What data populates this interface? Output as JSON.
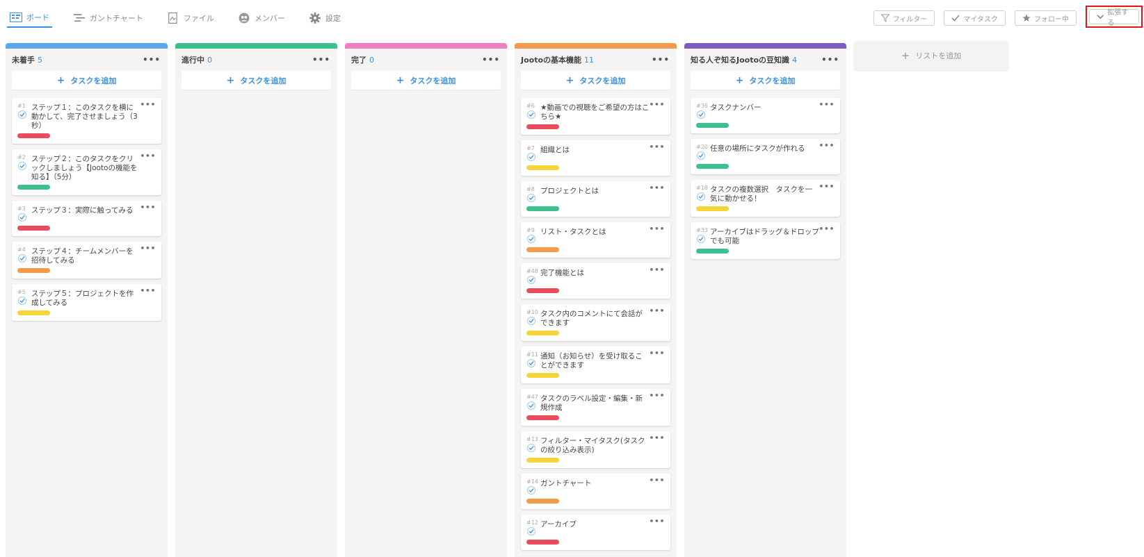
{
  "nav": {
    "tabs": [
      {
        "label": "ボード",
        "icon": "board-icon"
      },
      {
        "label": "ガントチャート",
        "icon": "gantt-icon"
      },
      {
        "label": "ファイル",
        "icon": "file-icon"
      },
      {
        "label": "メンバー",
        "icon": "member-icon"
      },
      {
        "label": "設定",
        "icon": "gear-icon"
      }
    ],
    "tools": {
      "filter": "フィルター",
      "mytask": "マイタスク",
      "follow": "フォロー中",
      "expand": "拡張する"
    }
  },
  "colors": {
    "accent": "#3b8fe0",
    "red": "#ea4c5c",
    "green": "#3cc08e",
    "orange": "#f39a4b",
    "yellow": "#f7d43a",
    "pink": "#ee7fbf",
    "purple": "#7e5cc2",
    "blue": "#5aa8ea"
  },
  "board": {
    "add_task_label": "タスクを追加",
    "add_list_label": "リストを追加",
    "columns": [
      {
        "name": "未着手",
        "count": "5",
        "color": "#5aa8ea",
        "cards": [
          {
            "num": "#1",
            "title": "ステップ１：このタスクを横に動かして、完了させましょう（3秒）",
            "label": "#ea4c5c"
          },
          {
            "num": "#2",
            "title": "ステップ２：このタスクをクリックしましょう【Jootoの機能を知る】（5分）",
            "label": "#3cc08e"
          },
          {
            "num": "#3",
            "title": "ステップ３：実際に触ってみる",
            "label": "#ea4c5c"
          },
          {
            "num": "#4",
            "title": "ステップ４：チームメンバーを招待してみる",
            "label": "#f39a4b"
          },
          {
            "num": "#5",
            "title": "ステップ５：プロジェクトを作成してみる",
            "label": "#f7d43a"
          }
        ]
      },
      {
        "name": "進行中",
        "count": "0",
        "color": "#3cc08e",
        "cards": []
      },
      {
        "name": "完了",
        "count": "0",
        "color": "#ee7fbf",
        "cards": []
      },
      {
        "name": "Jootoの基本機能",
        "count": "11",
        "color": "#f39a4b",
        "cards": [
          {
            "num": "#6",
            "title": "★動画での視聴をご希望の方はこちら★",
            "label": "#ea4c5c"
          },
          {
            "num": "#7",
            "title": "組織とは",
            "label": "#f7d43a"
          },
          {
            "num": "#8",
            "title": "プロジェクトとは",
            "label": "#3cc08e"
          },
          {
            "num": "#9",
            "title": "リスト・タスクとは",
            "label": "#f39a4b"
          },
          {
            "num": "#48",
            "title": "完了機能とは",
            "label": "#ea4c5c"
          },
          {
            "num": "#10",
            "title": "タスク内のコメントにて会話ができます",
            "label": "#f7d43a"
          },
          {
            "num": "#11",
            "title": "通知（お知らせ）を受け取ることができます",
            "label": "#f7d43a"
          },
          {
            "num": "#47",
            "title": "タスクのラベル設定・編集・新規作成",
            "label": "#ea4c5c"
          },
          {
            "num": "#13",
            "title": "フィルター・マイタスク(タスクの絞り込み表示)",
            "label": "#f7d43a"
          },
          {
            "num": "#14",
            "title": "ガントチャート",
            "label": "#f39a4b"
          },
          {
            "num": "#12",
            "title": "アーカイブ",
            "label": "#ea4c5c"
          }
        ]
      },
      {
        "name": "知る人ぞ知るJootoの豆知識",
        "count": "4",
        "color": "#7e5cc2",
        "cards": [
          {
            "num": "#36",
            "title": "タスクナンバー",
            "label": "#3cc08e"
          },
          {
            "num": "#20",
            "title": "任意の場所にタスクが作れる",
            "label": "#3cc08e"
          },
          {
            "num": "#18",
            "title": "タスクの複数選択　タスクを一気に動かせる！",
            "label": "#f7d43a"
          },
          {
            "num": "#33",
            "title": "アーカイブはドラッグ＆ドロップでも可能",
            "label": "#3cc08e"
          }
        ]
      }
    ]
  }
}
